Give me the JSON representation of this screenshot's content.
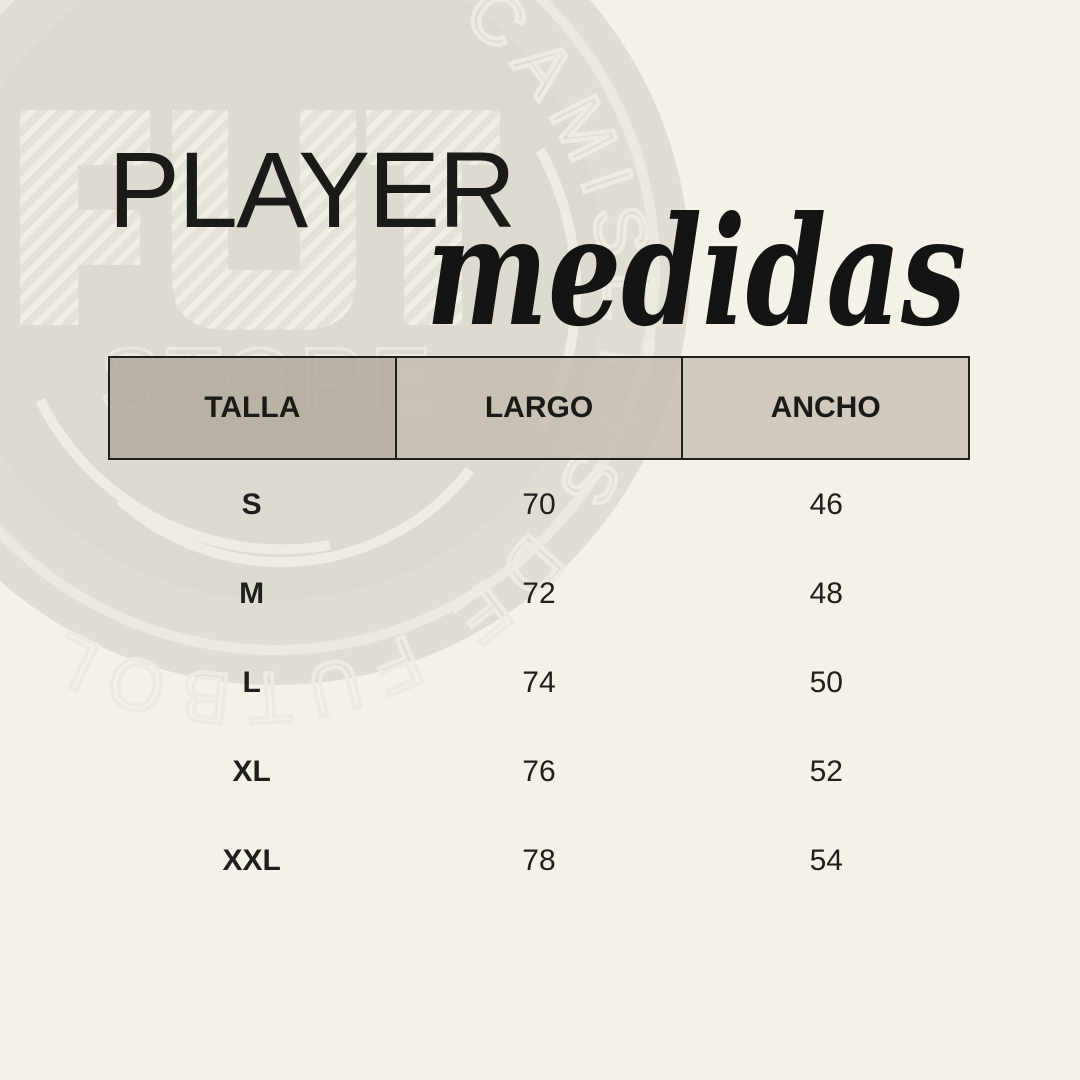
{
  "title": {
    "line1": "PLAYER",
    "line2": "medidas"
  },
  "watermark": {
    "logo_text": "FUT",
    "store_text": "STORE",
    "ring_text": "CAMISETAS DE FUTBOL RETRO"
  },
  "colors": {
    "background": "#f5f1e8",
    "text": "#1a1a18",
    "header_fill_1": "#b2aa9e",
    "header_fill_2": "#c4bdb2",
    "header_fill_3": "#cdc6bb",
    "watermark": "#dcd6cc"
  },
  "table": {
    "headers": [
      "TALLA",
      "LARGO",
      "ANCHO"
    ],
    "rows": [
      {
        "talla": "S",
        "largo": "70",
        "ancho": "46"
      },
      {
        "talla": "M",
        "largo": "72",
        "ancho": "48"
      },
      {
        "talla": "L",
        "largo": "74",
        "ancho": "50"
      },
      {
        "talla": "XL",
        "largo": "76",
        "ancho": "52"
      },
      {
        "talla": "XXL",
        "largo": "78",
        "ancho": "54"
      }
    ]
  }
}
